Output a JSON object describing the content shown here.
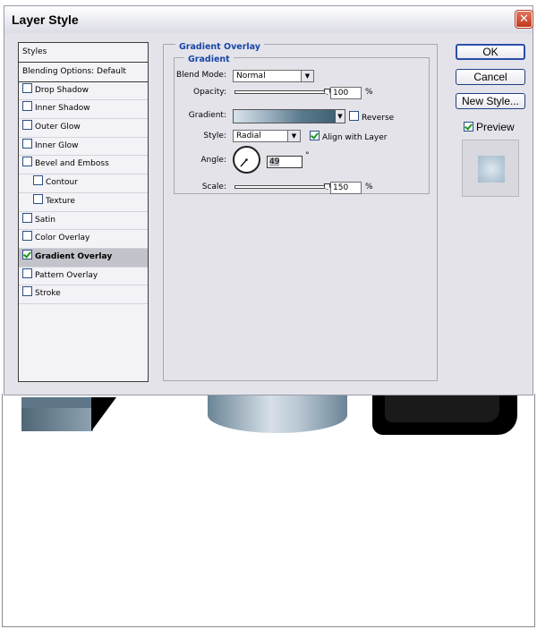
{
  "dialog": {
    "title": "Layer Style",
    "close_glyph": "✕"
  },
  "styles_list": {
    "header": "Styles",
    "items": [
      {
        "label": "Blending Options: Default",
        "has_checkbox": false,
        "checked": false,
        "selected": false,
        "indent": false
      },
      {
        "label": "Drop Shadow",
        "has_checkbox": true,
        "checked": false,
        "selected": false,
        "indent": false
      },
      {
        "label": "Inner Shadow",
        "has_checkbox": true,
        "checked": false,
        "selected": false,
        "indent": false
      },
      {
        "label": "Outer Glow",
        "has_checkbox": true,
        "checked": false,
        "selected": false,
        "indent": false
      },
      {
        "label": "Inner Glow",
        "has_checkbox": true,
        "checked": false,
        "selected": false,
        "indent": false
      },
      {
        "label": "Bevel and Emboss",
        "has_checkbox": true,
        "checked": false,
        "selected": false,
        "indent": false
      },
      {
        "label": "Contour",
        "has_checkbox": true,
        "checked": false,
        "selected": false,
        "indent": true
      },
      {
        "label": "Texture",
        "has_checkbox": true,
        "checked": false,
        "selected": false,
        "indent": true
      },
      {
        "label": "Satin",
        "has_checkbox": true,
        "checked": false,
        "selected": false,
        "indent": false
      },
      {
        "label": "Color Overlay",
        "has_checkbox": true,
        "checked": false,
        "selected": false,
        "indent": false
      },
      {
        "label": "Gradient Overlay",
        "has_checkbox": true,
        "checked": true,
        "selected": true,
        "indent": false
      },
      {
        "label": "Pattern Overlay",
        "has_checkbox": true,
        "checked": false,
        "selected": false,
        "indent": false
      },
      {
        "label": "Stroke",
        "has_checkbox": true,
        "checked": false,
        "selected": false,
        "indent": false
      }
    ]
  },
  "gradient_overlay": {
    "group_title": "Gradient Overlay",
    "subgroup_title": "Gradient",
    "blend_mode": {
      "label": "Blend Mode:",
      "value": "Normal"
    },
    "opacity": {
      "label": "Opacity:",
      "value": "100",
      "unit": "%",
      "level": 1.0
    },
    "gradient": {
      "label": "Gradient:",
      "colors": [
        "#d9e2ec",
        "#9db2c2",
        "#5b7a8e",
        "#3f6075"
      ]
    },
    "reverse": {
      "label": "Reverse",
      "checked": false
    },
    "style": {
      "label": "Style:",
      "value": "Radial"
    },
    "align_with_layer": {
      "label": "Align with Layer",
      "checked": true
    },
    "angle": {
      "label": "Angle:",
      "value": "49",
      "unit": "°",
      "degrees": 49
    },
    "scale": {
      "label": "Scale:",
      "value": "150",
      "unit": "%",
      "level": 1.0
    }
  },
  "buttons": {
    "ok": "OK",
    "cancel": "Cancel",
    "new_style": "New Style...",
    "preview_label": "Preview",
    "preview_checked": true
  },
  "colors": {
    "accent_blue": "#1846a8",
    "close_red": "#c0391d",
    "check_green": "#1a9a1a",
    "dialog_bg": "#e4e3ea"
  }
}
